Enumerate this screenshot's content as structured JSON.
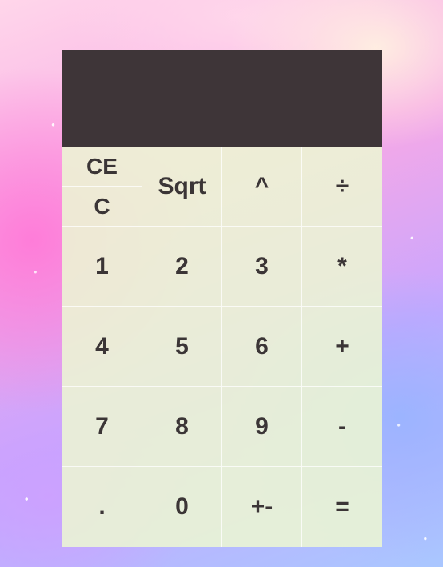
{
  "calculator": {
    "display_value": "",
    "keys": {
      "ce": "CE",
      "c": "C",
      "sqrt": "Sqrt",
      "power": "^",
      "divide": "÷",
      "one": "1",
      "two": "2",
      "three": "3",
      "multiply": "*",
      "four": "4",
      "five": "5",
      "six": "6",
      "plus": "+",
      "seven": "7",
      "eight": "8",
      "nine": "9",
      "minus": "-",
      "decimal": ".",
      "zero": "0",
      "plus_minus": "+-",
      "equals": "="
    }
  },
  "colors": {
    "display_background": "#3e3538",
    "keypad_background": "#ecf6d4",
    "key_text": "#3b3536"
  }
}
